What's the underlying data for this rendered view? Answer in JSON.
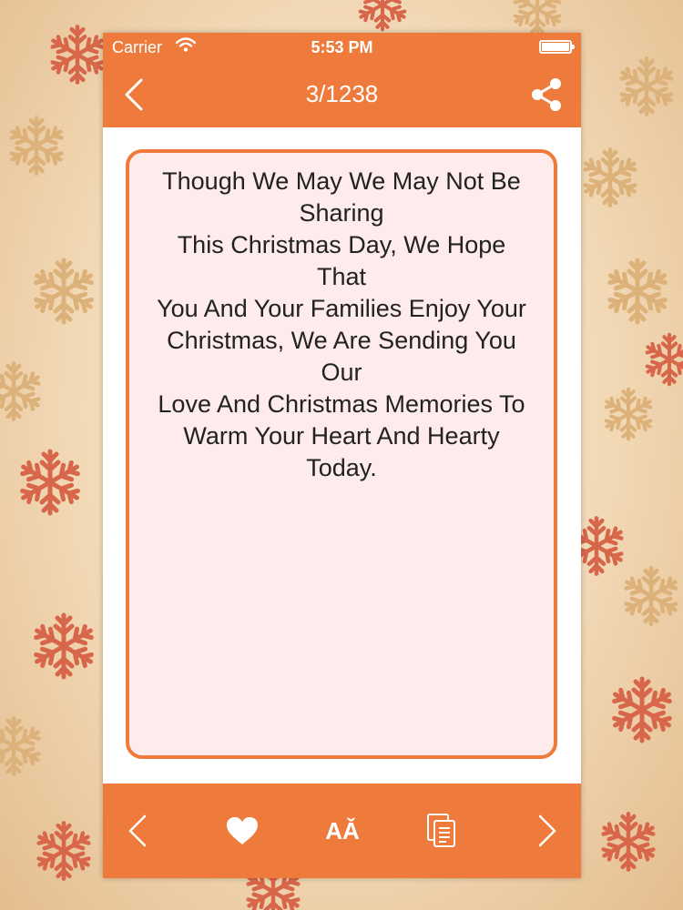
{
  "status_bar": {
    "carrier": "Carrier",
    "time": "5:53 PM"
  },
  "nav": {
    "title": "3/1238"
  },
  "quote": {
    "lines": [
      "Though We May We May Not Be",
      "Sharing",
      "This Christmas Day, We Hope",
      "That",
      "You And Your Families Enjoy Your",
      "Christmas, We Are Sending You",
      "Our",
      "Love And Christmas Memories To",
      "Warm Your Heart And Hearty",
      "Today."
    ]
  },
  "toolbar": {
    "font_size_label": "AǍ"
  },
  "colors": {
    "accent": "#ee7b3c",
    "card_background": "#fdeceb",
    "text": "#222222"
  },
  "icons": {
    "nav_back": "chevron-left-icon",
    "nav_share": "share-icon",
    "toolbar_prev": "chevron-left-icon",
    "toolbar_favorite": "heart-icon",
    "toolbar_font": "font-size-icon",
    "toolbar_copy": "copy-icon",
    "toolbar_next": "chevron-right-icon"
  }
}
